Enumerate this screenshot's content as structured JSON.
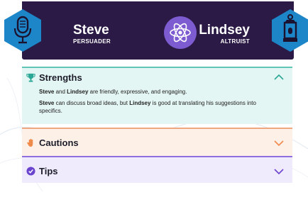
{
  "header": {
    "left_person": {
      "name": "Steve",
      "role": "PERSUADER",
      "icon": "microphone-icon"
    },
    "right_person": {
      "name": "Lindsey",
      "role": "ALTRUIST",
      "icon": "lantern-icon"
    },
    "center_icon": "atom-icon"
  },
  "strengths": {
    "title": "Strengths",
    "icon": "trophy-icon",
    "line1": {
      "a": "Steve",
      "b": " and ",
      "c": "Lindsey",
      "d": " are friendly, expressive, and engaging."
    },
    "line2": {
      "a": "Steve",
      "b": " can discuss broad ideas, but ",
      "c": "Lindsey",
      "d": " is good at translating his suggestions into specifics."
    },
    "expanded": true
  },
  "cautions": {
    "title": "Cautions",
    "icon": "hand-icon",
    "expanded": false
  },
  "tips": {
    "title": "Tips",
    "icon": "check-circle-icon",
    "expanded": false
  },
  "colors": {
    "header_bg": "#2b1a45",
    "hex_blue": "#1d86c8",
    "badge_purple": "#7d5bd0",
    "strengths_bg": "#e4f6f3",
    "strengths_accent": "#5fc6b5",
    "cautions_bg": "#fdf0e6",
    "cautions_accent": "#f0a77f",
    "tips_bg": "#efeafc",
    "tips_accent": "#8f6fe0"
  }
}
